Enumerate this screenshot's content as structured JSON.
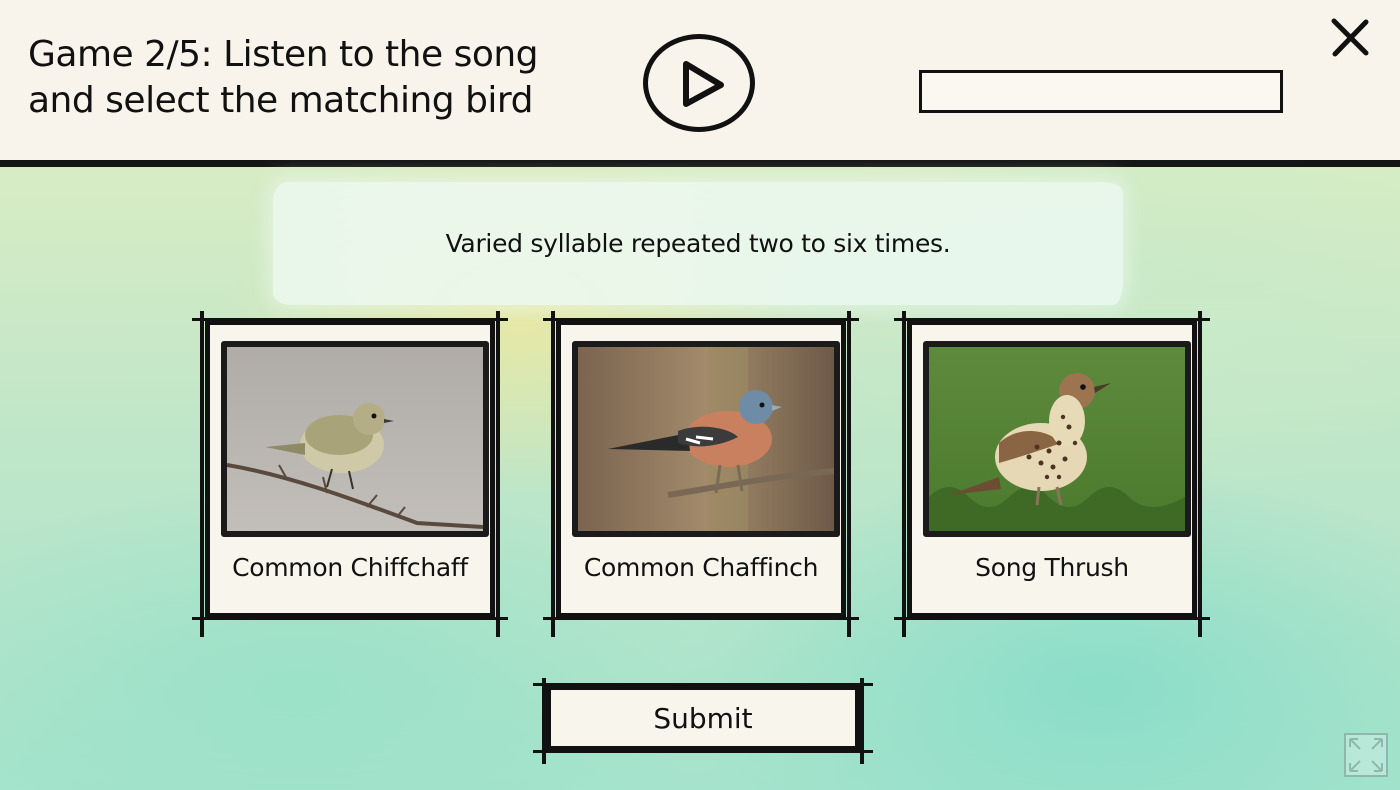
{
  "header": {
    "title": "Game 2/5: Listen to the song and select the matching bird",
    "play_icon": "play-icon",
    "close_icon": "close-icon",
    "progress_fraction": 0
  },
  "prompt": {
    "text": "Varied syllable repeated two to six times."
  },
  "options": [
    {
      "label": "Common Chiffchaff"
    },
    {
      "label": "Common Chaffinch"
    },
    {
      "label": "Song Thrush"
    }
  ],
  "submit_label": "Submit",
  "fullscreen_icon": "fullscreen-icon",
  "colors": {
    "ink": "#111111",
    "paper": "#f8f5ec",
    "background_green": "#a6e3cc",
    "background_yellow": "#ebe8a0"
  }
}
